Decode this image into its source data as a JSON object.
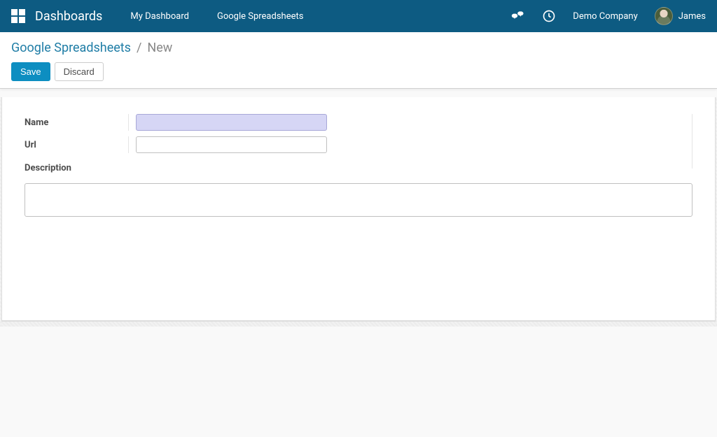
{
  "navbar": {
    "brand": "Dashboards",
    "links": {
      "my_dashboard": "My Dashboard",
      "google_spreadsheets": "Google Spreadsheets"
    },
    "company": "Demo Company",
    "user": "James"
  },
  "breadcrumb": {
    "parent": "Google Spreadsheets",
    "sep": "/",
    "current": "New"
  },
  "buttons": {
    "save": "Save",
    "discard": "Discard"
  },
  "form": {
    "labels": {
      "name": "Name",
      "url": "Url",
      "description": "Description"
    },
    "values": {
      "name": "",
      "url": "",
      "description": ""
    }
  }
}
